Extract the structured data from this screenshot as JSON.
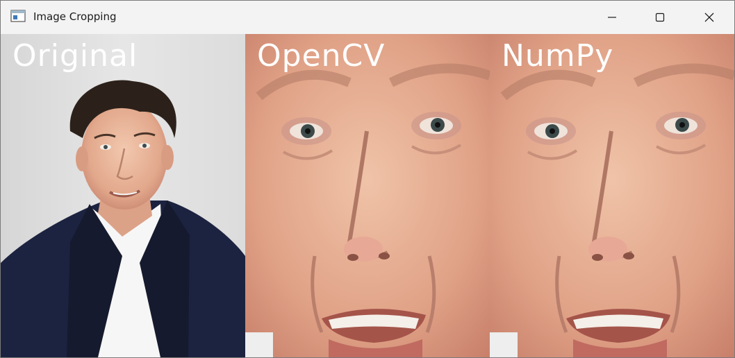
{
  "window": {
    "title": "Image Cropping",
    "icon": "app-window-icon",
    "controls": {
      "minimize_icon": "minimize-icon",
      "maximize_icon": "maximize-icon",
      "close_icon": "close-icon"
    }
  },
  "panels": [
    {
      "label": "Original",
      "content": "portrait-photo"
    },
    {
      "label": "OpenCV",
      "content": "face-crop-photo"
    },
    {
      "label": "NumPy",
      "content": "face-crop-photo"
    }
  ]
}
